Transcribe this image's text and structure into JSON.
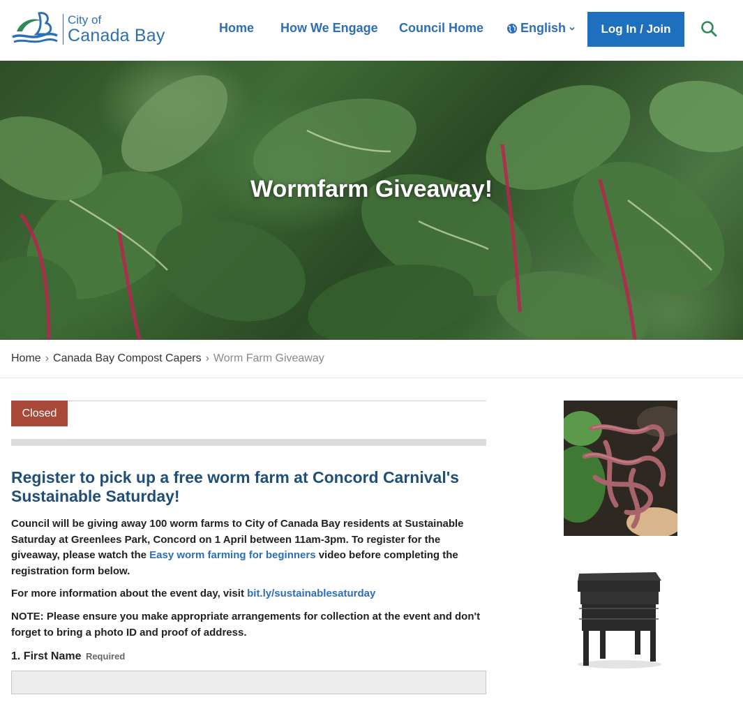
{
  "header": {
    "logo_small": "City of",
    "logo_big": "Canada Bay",
    "nav": [
      "Home",
      "How We Engage",
      "Council Home"
    ],
    "language": "English",
    "login_label": "Log In / Join",
    "search_icon": "search-icon",
    "brand_color": "#2d6fb7"
  },
  "hero": {
    "title": "Wormfarm Giveaway!"
  },
  "breadcrumb": {
    "items": [
      "Home",
      "Canada Bay Compost Capers"
    ],
    "current": "Worm Farm Giveaway"
  },
  "main": {
    "status": "Closed",
    "status_color": "#a8493a",
    "progress": 1.0,
    "headline": "Register to pick up a free worm farm at Concord Carnival's Sustainable Saturday!",
    "p1_before": "Council will be giving away 100 worm farms to City of Canada Bay residents at Sustainable Saturday at Greenlees Park, Concord on 1 April between 11am-3pm. To register for the giveaway, please watch the ",
    "p1_link": "Easy worm farming for beginners",
    "p1_after": " video before completing the registration form below.",
    "p2_before": "For more information about the event day, visit ",
    "p2_link": "bit.ly/sustainablesaturday",
    "p3": "NOTE: Please ensure you make appropriate arrangements for collection at the event and don't forget to bring a photo ID and proof of address.",
    "field1_label": "1. First Name",
    "field1_required": "Required",
    "field1_value": ""
  },
  "sidebar": {
    "image1_icon": "worms-photo",
    "image2_icon": "worm-farm-photo"
  }
}
